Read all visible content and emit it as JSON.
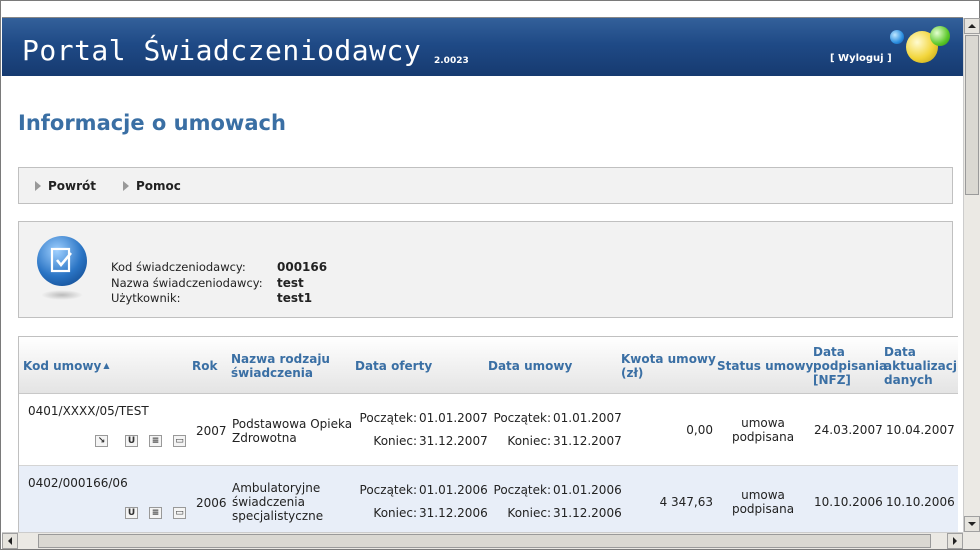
{
  "header": {
    "title": "Portal Świadczeniodawcy",
    "version": "2.0023",
    "logout": "[ Wyloguj ]"
  },
  "page": {
    "title": "Informacje o umowach"
  },
  "nav": {
    "items": [
      {
        "label": "Powrót"
      },
      {
        "label": "Pomoc"
      }
    ]
  },
  "info": {
    "icon": "document-check-icon",
    "fields": [
      {
        "label": "Kod świadczeniodawcy:",
        "value": "000166"
      },
      {
        "label": "Nazwa świadczeniodawcy:",
        "value": "test"
      },
      {
        "label": "Użytkownik:",
        "value": "test1"
      }
    ]
  },
  "table": {
    "headers": {
      "kod": "Kod umowy",
      "rok": "Rok",
      "nazwa1": "Nazwa rodzaju",
      "nazwa2": "świadczenia",
      "oferta": "Data oferty",
      "umowa": "Data umowy",
      "kwota1": "Kwota umowy",
      "kwota2": "(zł)",
      "status": "Status umowy",
      "podp1": "Data",
      "podp2": "podpisania",
      "podp3": "[NFZ]",
      "akt1": "Data",
      "akt2": "aktualizacji",
      "akt3": "danych",
      "sort_indicator": "▲"
    },
    "labels": {
      "start": "Początek:",
      "end": "Koniec:"
    },
    "rows": [
      {
        "kod": "0401/XXXX/05/TEST",
        "rok": "2007",
        "nazwa1": "Podstawowa Opieka",
        "nazwa2": "Zdrowotna",
        "nazwa3": "",
        "oferta_start": "01.01.2007",
        "oferta_end": "31.12.2007",
        "umowa_start": "01.01.2007",
        "umowa_end": "31.12.2007",
        "kwota": "0,00",
        "status1": "umowa",
        "status2": "podpisana",
        "podpisania": "24.03.2007",
        "aktualizacji": "10.04.2007",
        "icons": [
          "arrow-icon",
          "u-icon",
          "list-icon",
          "screen-icon"
        ]
      },
      {
        "kod": "0402/000166/06",
        "rok": "2006",
        "nazwa1": "Ambulatoryjne",
        "nazwa2": "świadczenia",
        "nazwa3": "specjalistyczne",
        "oferta_start": "01.01.2006",
        "oferta_end": "31.12.2006",
        "umowa_start": "01.01.2006",
        "umowa_end": "31.12.2006",
        "kwota": "4 347,63",
        "status1": "umowa",
        "status2": "podpisana",
        "podpisania": "10.10.2006",
        "aktualizacji": "10.10.2006",
        "icons": [
          "u-icon",
          "list-icon",
          "screen-icon"
        ]
      }
    ]
  }
}
